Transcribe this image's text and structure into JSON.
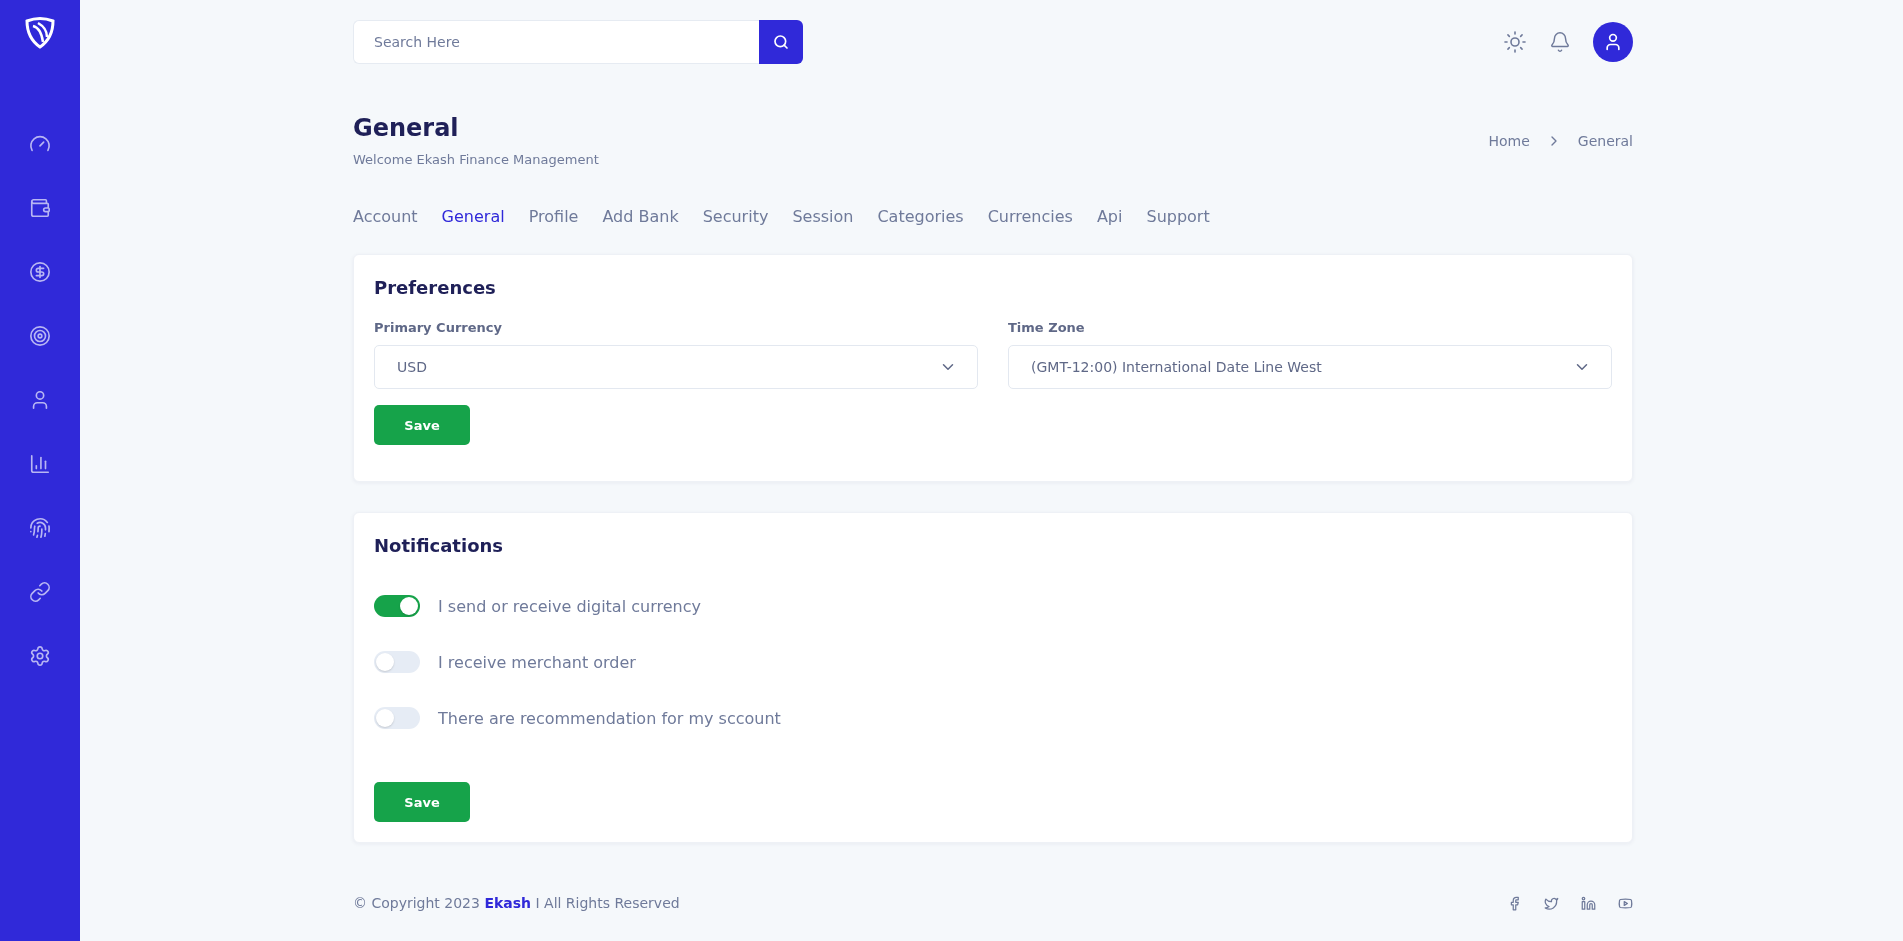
{
  "search": {
    "placeholder": "Search Here"
  },
  "page": {
    "title": "General",
    "subtitle": "Welcome Ekash Finance Management"
  },
  "breadcrumb": [
    "Home",
    "General"
  ],
  "tabs": [
    {
      "label": "Account",
      "selected": false
    },
    {
      "label": "General",
      "selected": true
    },
    {
      "label": "Profile",
      "selected": false
    },
    {
      "label": "Add Bank",
      "selected": false
    },
    {
      "label": "Security",
      "selected": false
    },
    {
      "label": "Session",
      "selected": false
    },
    {
      "label": "Categories",
      "selected": false
    },
    {
      "label": "Currencies",
      "selected": false
    },
    {
      "label": "Api",
      "selected": false
    },
    {
      "label": "Support",
      "selected": false
    }
  ],
  "preferences": {
    "title": "Preferences",
    "fields": [
      {
        "label": "Primary Currency",
        "value": "USD"
      },
      {
        "label": "Time Zone",
        "value": "(GMT-12:00) International Date Line West"
      }
    ],
    "button": "Save"
  },
  "notifications": {
    "title": "Notifications",
    "items": [
      {
        "label": "I send or receive digital currency",
        "on": true
      },
      {
        "label": "I receive merchant order",
        "on": false
      },
      {
        "label": "There are recommendation for my sccount",
        "on": false
      }
    ],
    "button": "Save"
  },
  "footer": {
    "prefix": "© Copyright 2023",
    "brand": "Ekash",
    "suffix": "I All Rights Reserved"
  }
}
